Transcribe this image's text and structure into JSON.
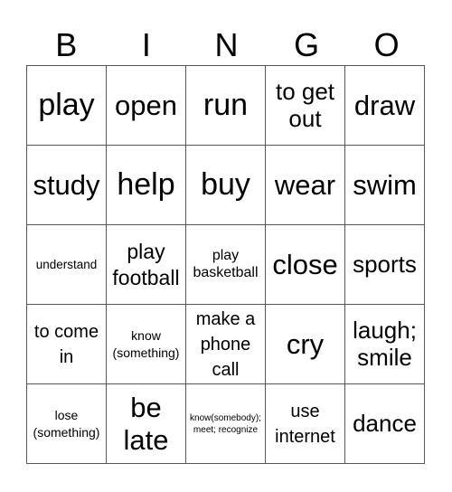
{
  "header": [
    "B",
    "I",
    "N",
    "G",
    "O"
  ],
  "rows": [
    [
      "play",
      "open",
      "run",
      "to get out",
      "draw"
    ],
    [
      "study",
      "help",
      "buy",
      "wear",
      "swim"
    ],
    [
      "understand",
      "play football",
      "play basketball",
      "close",
      "sports"
    ],
    [
      "to come in",
      "know (something)",
      "make a phone call",
      "cry",
      "laugh; smile"
    ],
    [
      "lose (something)",
      "be late",
      "know(somebody); meet; recognize",
      "use internet",
      "dance"
    ]
  ]
}
